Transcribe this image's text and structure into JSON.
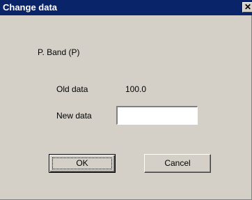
{
  "window": {
    "title": "Change data",
    "close_glyph": "✕"
  },
  "dialog": {
    "parameter_name": "P. Band (P)",
    "old_data_label": "Old data",
    "old_data_value": "100.0",
    "new_data_label": "New data",
    "new_data_value": ""
  },
  "buttons": {
    "ok_label": "OK",
    "cancel_label": "Cancel"
  },
  "colors": {
    "titlebar": "#0a246a",
    "face": "#d4d0c8"
  }
}
